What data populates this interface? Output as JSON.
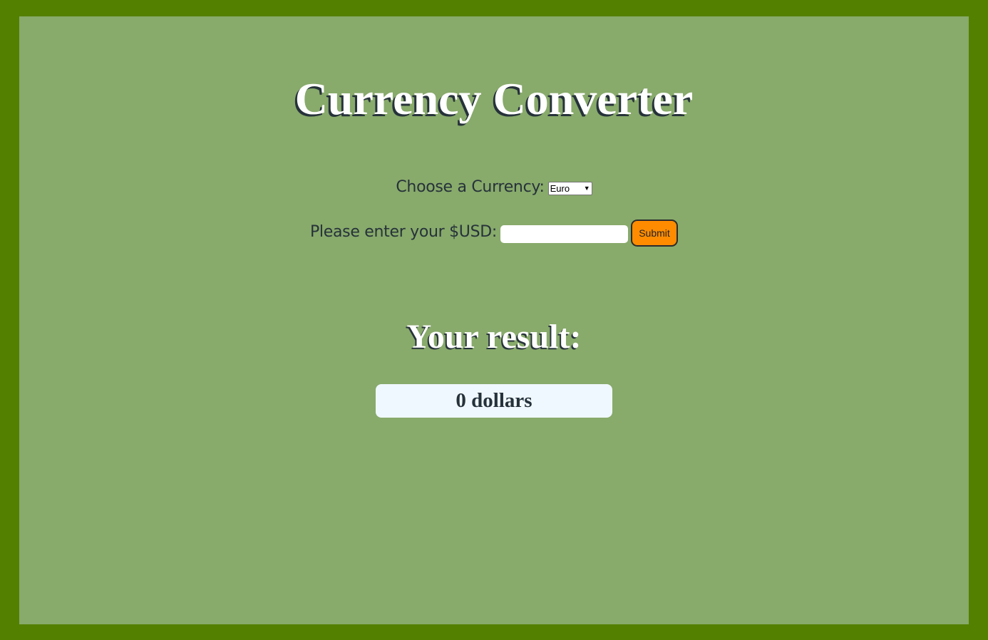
{
  "page": {
    "title": "Currency Converter",
    "colors": {
      "outer_background": "#548000",
      "panel_background": "#88aa6b",
      "text_dark": "#26323a",
      "submit_button": "#ff8c00",
      "result_box": "#f0f8ff"
    }
  },
  "form": {
    "currency_label": "Choose a Currency:",
    "currency_selected": "Euro",
    "usd_label": "Please enter your $USD:",
    "usd_value": "",
    "submit_label": "Submit"
  },
  "result": {
    "heading": "Your result:",
    "value": "0 dollars"
  },
  "icons": {
    "select_chevron": "chevron-down-icon"
  }
}
